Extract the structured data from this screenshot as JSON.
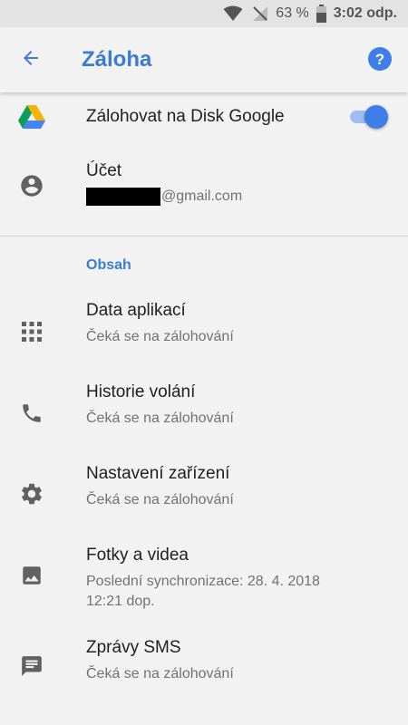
{
  "status_bar": {
    "battery_percent": "63 %",
    "time": "3:02 odp."
  },
  "header": {
    "title": "Záloha"
  },
  "backup_toggle": {
    "label": "Zálohovat na Disk Google",
    "enabled": true
  },
  "account": {
    "label": "Účet",
    "email_suffix": "@gmail.com"
  },
  "section": {
    "title": "Obsah"
  },
  "items": [
    {
      "title": "Data aplikací",
      "subtitle": "Čeká se na zálohování",
      "icon": "apps-grid-icon"
    },
    {
      "title": "Historie volání",
      "subtitle": "Čeká se na zálohování",
      "icon": "phone-icon"
    },
    {
      "title": "Nastavení zařízení",
      "subtitle": "Čeká se na zálohování",
      "icon": "gear-icon"
    },
    {
      "title": "Fotky a videa",
      "subtitle": "Poslední synchronizace: 28. 4. 2018 12:21 dop.",
      "icon": "image-icon"
    },
    {
      "title": "Zprávy SMS",
      "subtitle": "Čeká se na zálohování",
      "icon": "message-icon"
    }
  ],
  "colors": {
    "accent": "#3a7bd5",
    "toggle_thumb": "#3e7ee8",
    "background": "#f2f2f2",
    "status_bar": "#e3e3e3"
  }
}
